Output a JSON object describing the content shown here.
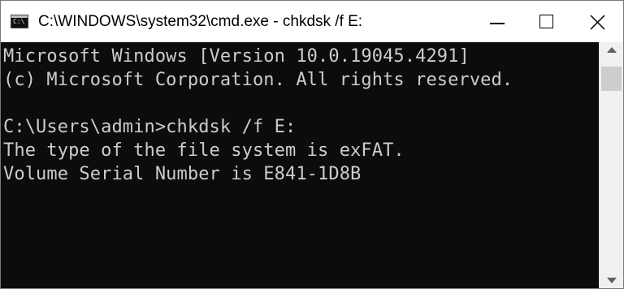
{
  "window": {
    "title": "C:\\WINDOWS\\system32\\cmd.exe - chkdsk  /f E:",
    "app_icon": "command-prompt-icon",
    "app_icon_glyph": "C:\\",
    "minimize_icon": "minimize-icon",
    "maximize_icon": "maximize-icon",
    "close_icon": "close-icon"
  },
  "console": {
    "background": "#0c0c0c",
    "foreground": "#cccccc",
    "lines": [
      "Microsoft Windows [Version 10.0.19045.4291]",
      "(c) Microsoft Corporation. All rights reserved.",
      "",
      "C:\\Users\\admin>chkdsk /f E:",
      "The type of the file system is exFAT.",
      "Volume Serial Number is E841-1D8B"
    ]
  },
  "scrollbar": {
    "up_icon": "scroll-up-arrow-icon",
    "down_icon": "scroll-down-arrow-icon"
  }
}
